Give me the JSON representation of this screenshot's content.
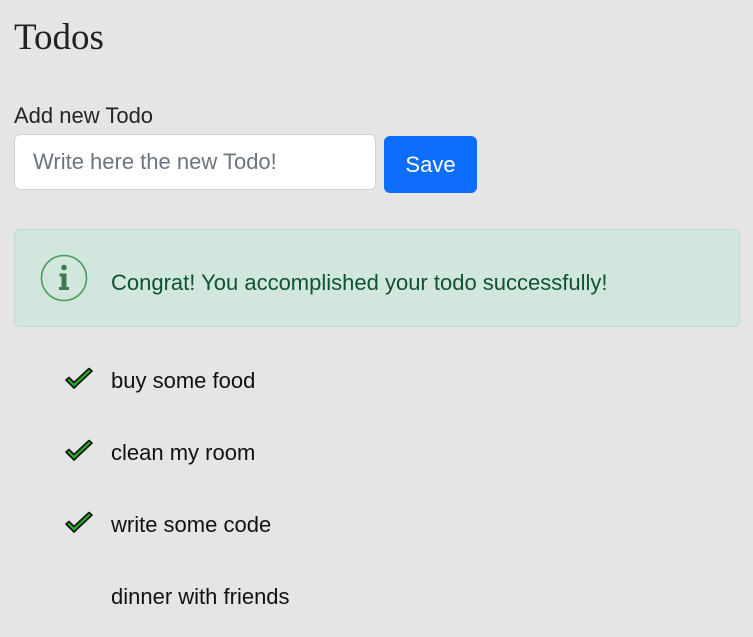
{
  "page": {
    "title": "Todos"
  },
  "form": {
    "label": "Add new Todo",
    "input_value": "",
    "input_placeholder": "Write here the new Todo!",
    "save_label": "Save"
  },
  "alert": {
    "icon": "info-icon",
    "message": "Congrat! You accomplished your todo successfully!",
    "color": "#0f5132",
    "background": "#d1e7dd"
  },
  "todos": [
    {
      "text": "buy some food",
      "done": true
    },
    {
      "text": "clean my room",
      "done": true
    },
    {
      "text": "write some code",
      "done": true
    },
    {
      "text": "dinner with friends",
      "done": false
    }
  ],
  "colors": {
    "accent": "#0d6efd",
    "check": "#22aa22"
  }
}
